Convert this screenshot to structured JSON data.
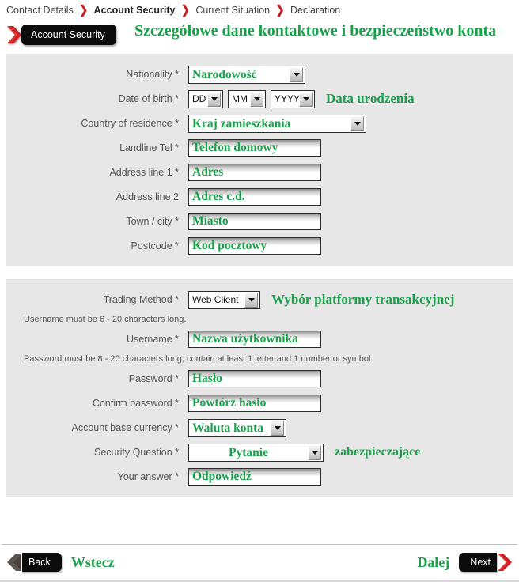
{
  "breadcrumb": {
    "items": [
      {
        "label": "Contact Details",
        "active": false
      },
      {
        "label": "Account Security",
        "active": true
      },
      {
        "label": "Current Situation",
        "active": false
      },
      {
        "label": "Declaration",
        "active": false
      }
    ],
    "separator": "❯",
    "separator_color": "#c62026"
  },
  "header": {
    "tab_label": "Account Security",
    "heading": "Szczegółowe dane kontaktowe i bezpieczeństwo konta",
    "accent_green": "#18a04a",
    "accent_red": "#c62026"
  },
  "panel_contact": {
    "rows": [
      {
        "label": "Nationality *",
        "value": "Narodowość",
        "type": "select",
        "width": "w-nationality",
        "note": ""
      },
      {
        "label": "Date of birth *",
        "type": "date",
        "day": "DD",
        "month": "MM",
        "year": "YYYY",
        "note": "Data urodzenia"
      },
      {
        "label": "Country of residence *",
        "value": "Kraj zamieszkania",
        "type": "select",
        "width": "w-country",
        "note": ""
      },
      {
        "label": "Landline Tel *",
        "value": "Telefon domowy",
        "type": "text",
        "note": ""
      },
      {
        "label": "Address line 1 *",
        "value": "Adres",
        "type": "text",
        "note": ""
      },
      {
        "label": "Address line 2",
        "value": "Adres c.d.",
        "type": "text",
        "note": ""
      },
      {
        "label": "Town / city *",
        "value": "Miasto",
        "type": "text",
        "note": ""
      },
      {
        "label": "Postcode *",
        "value": "Kod pocztowy",
        "type": "text",
        "note": ""
      }
    ]
  },
  "panel_security": {
    "trading_method": {
      "label": "Trading Method *",
      "value": "Web Client",
      "note": "Wybór platformy transakcyjnej"
    },
    "username_hint": "Username must be 6 - 20 characters long.",
    "username": {
      "label": "Username *",
      "value": "Nazwa użytkownika"
    },
    "password_hint": "Password must be 8 - 20 characters long, contain at least 1 letter and 1 number or symbol.",
    "password": {
      "label": "Password *",
      "value": "Hasło"
    },
    "confirm_password": {
      "label": "Confirm password *",
      "value": "Powtórz hasło"
    },
    "base_currency": {
      "label": "Account base currency *",
      "value": "Waluta konta"
    },
    "security_question": {
      "label": "Security Question *",
      "value": "Pytanie",
      "note": "zabezpieczające"
    },
    "your_answer": {
      "label": "Your answer *",
      "value": "Odpowiedź"
    }
  },
  "footer": {
    "back_label": "Back",
    "back_note": "Wstecz",
    "next_label": "Next",
    "next_note": "Dalej"
  }
}
